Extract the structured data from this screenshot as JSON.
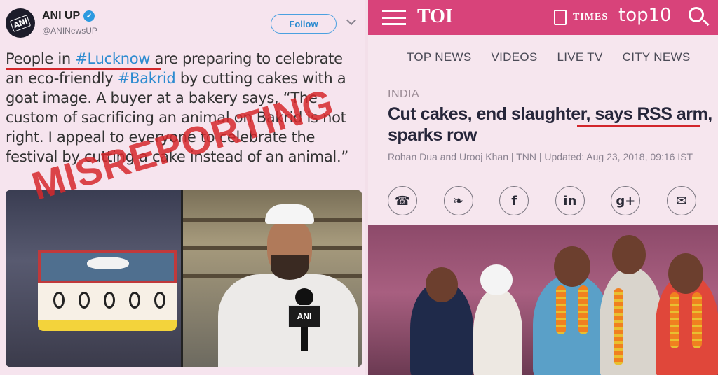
{
  "tweet": {
    "avatar_text": "ANI",
    "name": "ANI UP",
    "handle": "@ANINewsUP",
    "follow_label": "Follow",
    "body_parts": {
      "a": "People in ",
      "tag1": "#Lucknow",
      "b": " are preparing to celebrate an eco-friendly ",
      "tag2": "#Bakrid",
      "c": " by cutting cakes with a goat image. A buyer at a bakery says, “The custom of sacrificing an animal on Bakrid is not right. I appeal to everyone to celebrate the festival by cutting a cake instead of an animal.”"
    },
    "mic_logo": "ANI"
  },
  "stamp": "MISREPORTING",
  "toi": {
    "logo": "TOI",
    "times_label": "TIMES",
    "top10_label": "top10",
    "nav": [
      "TOP NEWS",
      "VIDEOS",
      "LIVE TV",
      "CITY NEWS"
    ],
    "section": "INDIA",
    "headline": "Cut cakes, end slaughter, says RSS arm, sparks row",
    "byline": "Rohan Dua and Urooj Khan | TNN | Updated: Aug 23, 2018, 09:16 IST",
    "share_icons": [
      "whatsapp-icon",
      "twitter-icon",
      "facebook-icon",
      "linkedin-icon",
      "googleplus-icon",
      "email-icon"
    ],
    "share_glyphs": [
      "☎",
      "❧",
      "f",
      "in",
      "g+",
      "✉"
    ]
  },
  "colors": {
    "toi_bar": "#d8437a",
    "link_blue": "#2d8bd0",
    "stamp_red": "#d6282c",
    "underline_red": "#d3262b"
  }
}
